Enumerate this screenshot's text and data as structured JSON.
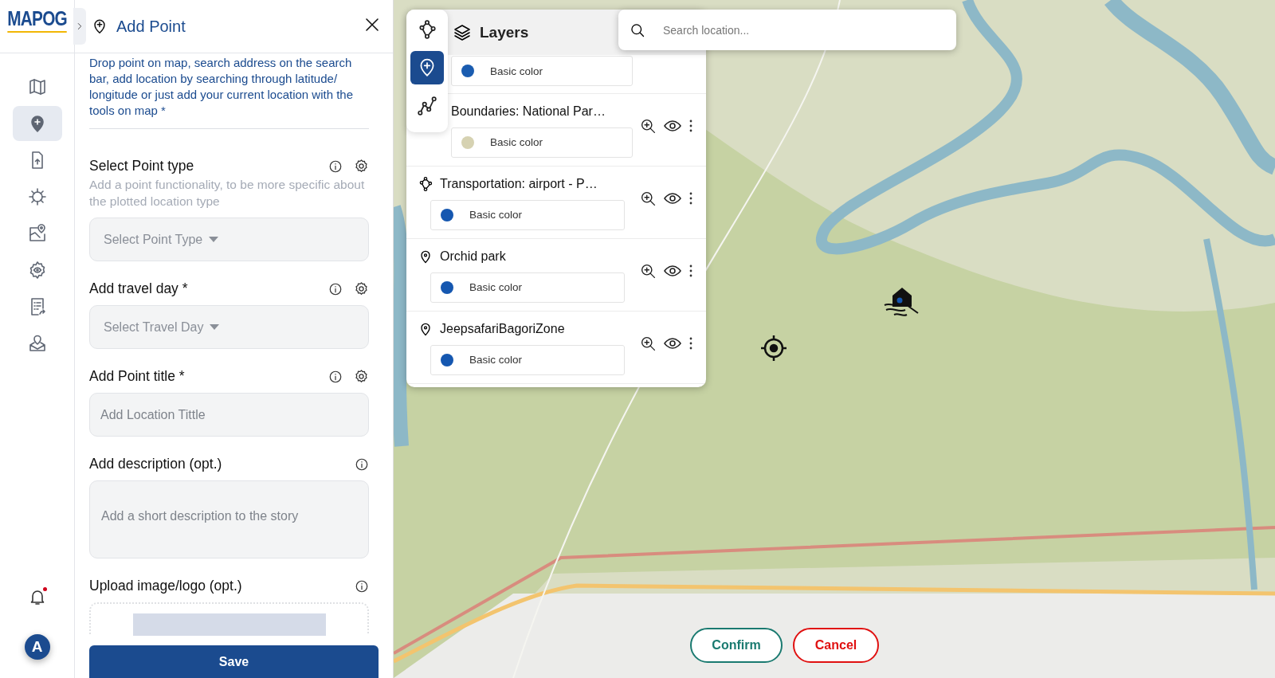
{
  "rail": {
    "logo": "MAPOG",
    "items": [
      {
        "kind": "map",
        "selected": false
      },
      {
        "kind": "add-point",
        "selected": true
      },
      {
        "kind": "upload",
        "selected": false
      },
      {
        "kind": "cog",
        "selected": false
      },
      {
        "kind": "map-pin",
        "selected": false
      },
      {
        "kind": "settings",
        "selected": false
      },
      {
        "kind": "list",
        "selected": false
      },
      {
        "kind": "location",
        "selected": false
      }
    ],
    "notification_dot": true,
    "avatar": "A"
  },
  "panel": {
    "title": "Add Point",
    "intro": "Drop point on map, search address on the search bar, add location by searching through latitude/ longitude or just add your current location with the tools on map *",
    "fields": [
      {
        "kind": "select",
        "label": "Select Point type",
        "help": "Add a point functionality, to be more specific about the plotted location type",
        "info": true,
        "settings": true,
        "placeholder": "Select Point Type"
      },
      {
        "kind": "select",
        "label": "Add travel day *",
        "info": true,
        "settings": true,
        "placeholder": "Select Travel Day"
      },
      {
        "kind": "text",
        "label": "Add Point title *",
        "info": true,
        "settings": true,
        "placeholder": "Add Location Tittle"
      },
      {
        "kind": "textarea",
        "label": "Add description (opt.)",
        "info": true,
        "settings": false,
        "placeholder": "Add a short description to the story"
      },
      {
        "kind": "upload",
        "label": "Upload image/logo (opt.)",
        "info": true,
        "settings": false
      }
    ],
    "save": "Save"
  },
  "map": {
    "search_placeholder": "Search location...",
    "tools": [
      {
        "kind": "polygon",
        "selected": false
      },
      {
        "kind": "point",
        "selected": true
      },
      {
        "kind": "line",
        "selected": false
      }
    ],
    "layers": {
      "title": "Layers",
      "items": [
        {
          "style": "Basic color",
          "color": "#1a5cb0"
        },
        {
          "name": "Boundaries: National Par…",
          "style": "Basic color",
          "color": "#d6d2b2"
        },
        {
          "kind": "polygon",
          "name": "Transportation: airport - P…",
          "style": "Basic color",
          "color": "#1557b0"
        },
        {
          "kind": "point",
          "name": "Orchid park",
          "style": "Basic color",
          "color": "#1557b0"
        },
        {
          "kind": "point",
          "name": "JeepsafariBagoriZone",
          "style": "Basic color",
          "color": "#1557b0"
        }
      ]
    },
    "confirm": "Confirm",
    "cancel": "Cancel"
  }
}
